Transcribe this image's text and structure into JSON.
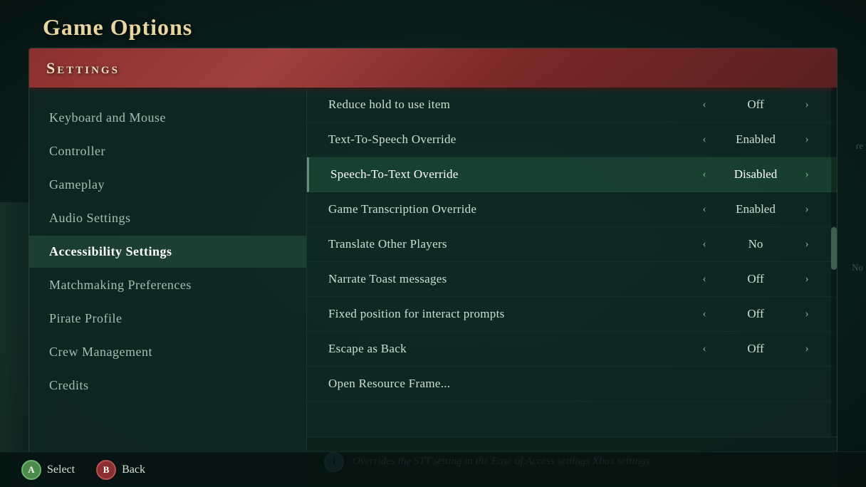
{
  "title": "Game Options",
  "topBadge": "◀ ▶",
  "settingsHeader": "Settings",
  "sidebar": {
    "items": [
      {
        "id": "keyboard-mouse",
        "label": "Keyboard and Mouse",
        "active": false
      },
      {
        "id": "controller",
        "label": "Controller",
        "active": false
      },
      {
        "id": "gameplay",
        "label": "Gameplay",
        "active": false
      },
      {
        "id": "audio-settings",
        "label": "Audio Settings",
        "active": false
      },
      {
        "id": "accessibility-settings",
        "label": "Accessibility Settings",
        "active": true
      },
      {
        "id": "matchmaking-preferences",
        "label": "Matchmaking Preferences",
        "active": false
      },
      {
        "id": "pirate-profile",
        "label": "Pirate Profile",
        "active": false
      },
      {
        "id": "crew-management",
        "label": "Crew Management",
        "active": false
      },
      {
        "id": "credits",
        "label": "Credits",
        "active": false
      }
    ]
  },
  "settingsRows": [
    {
      "id": "reduce-hold",
      "name": "Reduce hold to use item",
      "value": "Off",
      "selected": false
    },
    {
      "id": "text-to-speech",
      "name": "Text-To-Speech Override",
      "value": "Enabled",
      "selected": false
    },
    {
      "id": "speech-to-text",
      "name": "Speech-To-Text Override",
      "value": "Disabled",
      "selected": true
    },
    {
      "id": "game-transcription",
      "name": "Game Transcription Override",
      "value": "Enabled",
      "selected": false
    },
    {
      "id": "translate-players",
      "name": "Translate Other Players",
      "value": "No",
      "selected": false
    },
    {
      "id": "narrate-toast",
      "name": "Narrate Toast messages",
      "value": "Off",
      "selected": false
    },
    {
      "id": "fixed-position",
      "name": "Fixed position for interact prompts",
      "value": "Off",
      "selected": false
    },
    {
      "id": "escape-back",
      "name": "Escape as Back",
      "value": "Off",
      "selected": false
    },
    {
      "id": "open-resource",
      "name": "Open Resource Frame...",
      "value": "",
      "selected": false
    }
  ],
  "infoText": "Overrides the STT setting in the Ease of Access settings Xbox settings.",
  "infoIcon": "i",
  "bottomButtons": [
    {
      "id": "select-btn",
      "circle": "A",
      "label": "Select",
      "type": "a"
    },
    {
      "id": "back-btn",
      "circle": "B",
      "label": "Back",
      "type": "b"
    }
  ],
  "arrowLeft": "‹",
  "arrowRight": "›",
  "cornerTexts": [
    "re",
    "No"
  ]
}
